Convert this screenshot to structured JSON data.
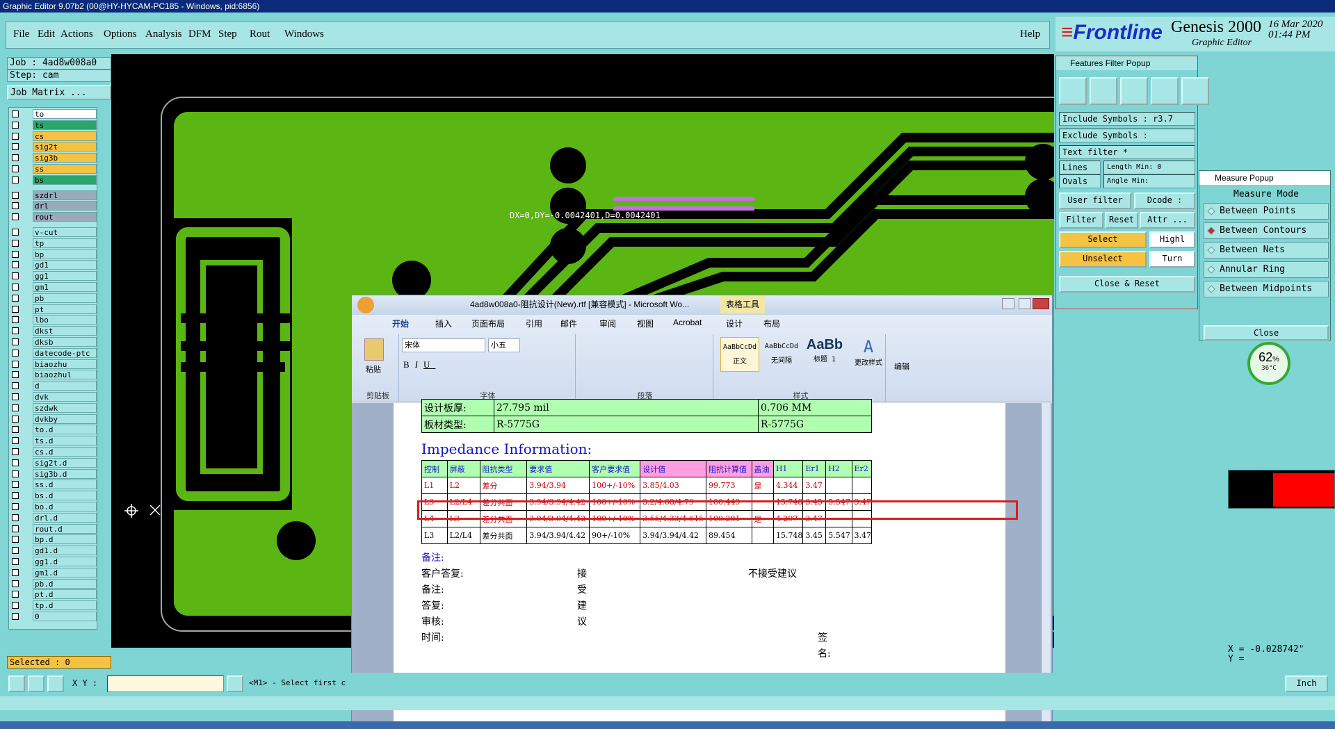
{
  "window_title": "Graphic Editor 9.07b2 (00@HY-HYCAM-PC185 - Windows, pid:6856)",
  "menu": {
    "items": [
      "File",
      "Edit",
      "Actions",
      "Options",
      "Analysis",
      "DFM",
      "Step",
      "Rout",
      "Windows"
    ],
    "help": "Help"
  },
  "logo": {
    "brand": "Frontline",
    "product": "Genesis 2000",
    "subtitle": "Graphic Editor",
    "date": "16 Mar 2020",
    "time": "01:44 PM"
  },
  "job": {
    "job": "Job : 4ad8w008a0",
    "step": "Step: cam",
    "matrix": "Job Matrix ..."
  },
  "layers": [
    "to",
    "ts",
    "cs",
    "sig2t",
    "sig3b",
    "ss",
    "bs",
    "szdrl",
    "drl",
    "rout",
    "v-cut",
    "tp",
    "bp",
    "gd1",
    "gg1",
    "gm1",
    "pb",
    "pt",
    "lbo",
    "dkst",
    "dksb",
    "datecode-ptc",
    "biaozhu",
    "biaozhul",
    "d",
    "dvk",
    "szdwk",
    "dvkby",
    "to.d",
    "ts.d",
    "cs.d",
    "sig2t.d",
    "sig3b.d",
    "ss.d",
    "bs.d",
    "bo.d",
    "drl.d",
    "rout.d",
    "bp.d",
    "gd1.d",
    "gg1.d",
    "gm1.d",
    "pb.d",
    "pt.d",
    "tp.d",
    "0"
  ],
  "selected": "Selected : 0",
  "measure_readout": "DX=0,DY=-0.0042401,D=0.0042401",
  "features_filter": {
    "title": "Features Filter Popup",
    "include_label": "Include Symbols :",
    "include_value": "r3.7",
    "exclude_label": "Exclude Symbols :",
    "exclude_value": "",
    "text_filter_label": "Text filter",
    "text_filter_value": "*",
    "lines": "Lines",
    "ovals": "Ovals",
    "length": "Length",
    "angle": "Angle",
    "min": "Min:",
    "min_value": "0",
    "user_filter": "User filter ...",
    "dcode": "Dcode :",
    "filter": "Filter",
    "reset": "Reset",
    "attr": "Attr ...",
    "select": "Select",
    "unselect": "Unselect",
    "highlight": "Highl",
    "turn": "Turn",
    "close_reset": "Close & Reset"
  },
  "measure": {
    "title": "Measure Popup",
    "mode": "Measure Mode",
    "options": [
      "Between Points",
      "Between Contours",
      "Between Nets",
      "Annular Ring",
      "Between Midpoints"
    ],
    "close": "Close"
  },
  "temp_badge": {
    "percent": "62",
    "unit": "%",
    "temp": "36°C"
  },
  "coords": {
    "x": "X = -0.028742\"",
    "y": "Y ="
  },
  "word": {
    "title": "4ad8w008a0-阻抗设计(New).rtf [兼容模式] - Microsoft Wo...",
    "tools_tab": "表格工具",
    "tabs": [
      "开始",
      "插入",
      "页面布局",
      "引用",
      "邮件",
      "审阅",
      "视图",
      "Acrobat",
      "设计",
      "布局"
    ],
    "groups": {
      "clipboard": "剪贴板",
      "font": "字体",
      "paragraph": "段落",
      "styles": "样式",
      "edit": "编辑"
    },
    "paste": "粘贴",
    "font_name": "宋体",
    "font_size": "小五",
    "style1": "正文",
    "style2": "无间隔",
    "style3": "标题 1",
    "style_preview": "AaBbCcDd",
    "style_preview_big": "AaBb",
    "change_styles": "更改样式",
    "top_rows": [
      [
        "设计板厚:",
        "27.795 mil",
        "0.706 MM"
      ],
      [
        "板材类型:",
        "R-5775G",
        "R-5775G"
      ]
    ],
    "impedance_title": "Impedance Information:",
    "headers": [
      "控制",
      "屏蔽",
      "阻抗类型",
      "要求值",
      "客户要求值",
      "设计值",
      "阻抗计算值",
      "盖油",
      "H1",
      "Er1",
      "H2",
      "Er2"
    ],
    "rows": [
      [
        "L1",
        "L2",
        "差分",
        "3.94/3.94",
        "100+/-10%",
        "3.85/4.03",
        "99.773",
        "是",
        "4.344",
        "3.47",
        "",
        ""
      ],
      [
        "L3",
        "L2/L4",
        "差分共面",
        "3.94/3.94/4.42",
        "100+/-10%",
        "3.2/4.68/4.79",
        "100.449",
        "",
        "15.748",
        "3.45",
        "5.547",
        "3.47"
      ],
      [
        "L4",
        "L3",
        "差分共面",
        "3.94/3.94/4.42",
        "100+/-10%",
        "3.55/4.33/4.615",
        "100.281",
        "是",
        "4.297",
        "3.47",
        "",
        ""
      ],
      [
        "L3",
        "L2/L4",
        "差分共面",
        "3.94/3.94/4.42",
        "90+/-10%",
        "3.94/3.94/4.42",
        "89.454",
        "",
        "15.748",
        "3.45",
        "5.547",
        "3.47"
      ]
    ],
    "notes": {
      "remark1": "备注:",
      "customer": "客户答复:",
      "accept": "接受建议",
      "reject": "不接受建议",
      "remark2": "备注:",
      "reply": "答复:",
      "review": "审核:",
      "time": "时间:",
      "sign": "签名:"
    }
  },
  "cmd": {
    "xy_label": "X Y :",
    "prompt": "<M1> - Select first c",
    "unit": "Inch"
  }
}
